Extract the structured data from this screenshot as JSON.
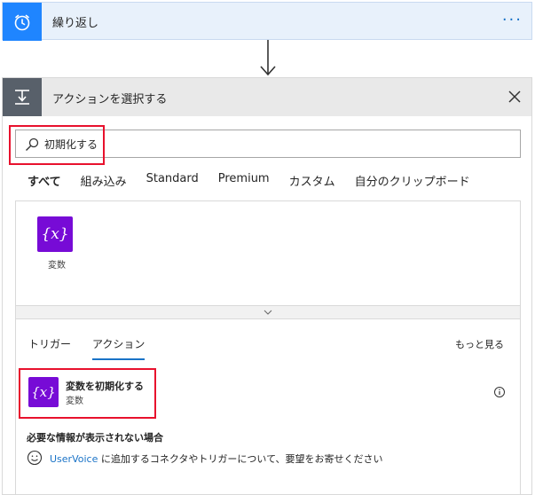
{
  "trigger": {
    "title": "繰り返し",
    "more_label": "···"
  },
  "action_picker": {
    "title": "アクションを選択する",
    "search": {
      "value": "初期化する",
      "placeholder": ""
    },
    "tabs": [
      {
        "label": "すべて",
        "active": true
      },
      {
        "label": "組み込み",
        "active": false
      },
      {
        "label": "Standard",
        "active": false
      },
      {
        "label": "Premium",
        "active": false
      },
      {
        "label": "カスタム",
        "active": false
      },
      {
        "label": "自分のクリップボード",
        "active": false
      }
    ],
    "connectors": [
      {
        "name": "変数",
        "icon": "variable-icon",
        "icon_text": "{x}"
      }
    ],
    "subtabs": [
      {
        "label": "トリガー",
        "active": false
      },
      {
        "label": "アクション",
        "active": true
      }
    ],
    "see_more": "もっと見る",
    "results": [
      {
        "title": "変数を初期化する",
        "subtitle": "変数",
        "icon_text": "{x}"
      }
    ],
    "help": {
      "title": "必要な情報が表示されない場合",
      "link": "UserVoice",
      "text": " に追加するコネクタやトリガーについて、要望をお寄せください"
    }
  },
  "colors": {
    "trigger_accent": "#1f85ff",
    "trigger_bg": "#e8f1fb",
    "action_header_bg": "#e9e9e9",
    "action_icon_bg": "#58606a",
    "variable_icon_bg": "#770bd6",
    "highlight": "#e8112d",
    "link": "#1a73c7"
  }
}
